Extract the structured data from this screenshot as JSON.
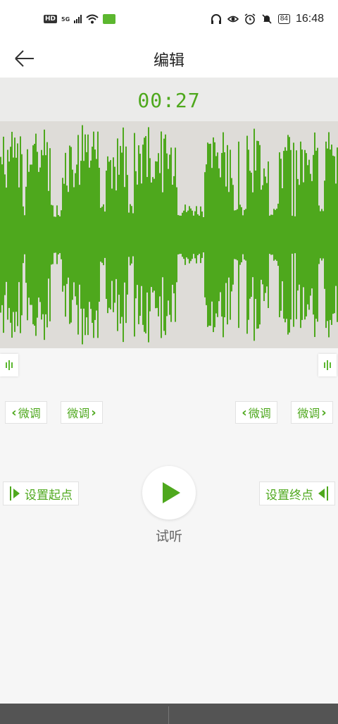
{
  "status_bar": {
    "network": "5G",
    "hd_label": "HD",
    "battery": "84",
    "time": "16:48",
    "icons": [
      "hd-icon",
      "signal-icon",
      "wifi-icon",
      "wechat-icon",
      "headphones-icon",
      "eye-icon",
      "alarm-icon",
      "mute-icon",
      "battery-icon"
    ]
  },
  "header": {
    "title": "编辑",
    "back_icon": "back-arrow-icon"
  },
  "player": {
    "current_time": "00:27",
    "play_label": "试听",
    "accent_color": "#4ea81d"
  },
  "fine_tune": {
    "start_minus": "微调",
    "start_plus": "微调",
    "end_minus": "微调",
    "end_plus": "微调"
  },
  "markers": {
    "set_start": "设置起点",
    "set_end": "设置终点"
  },
  "bottom_bar": {
    "left_label": "",
    "right_label": ""
  }
}
